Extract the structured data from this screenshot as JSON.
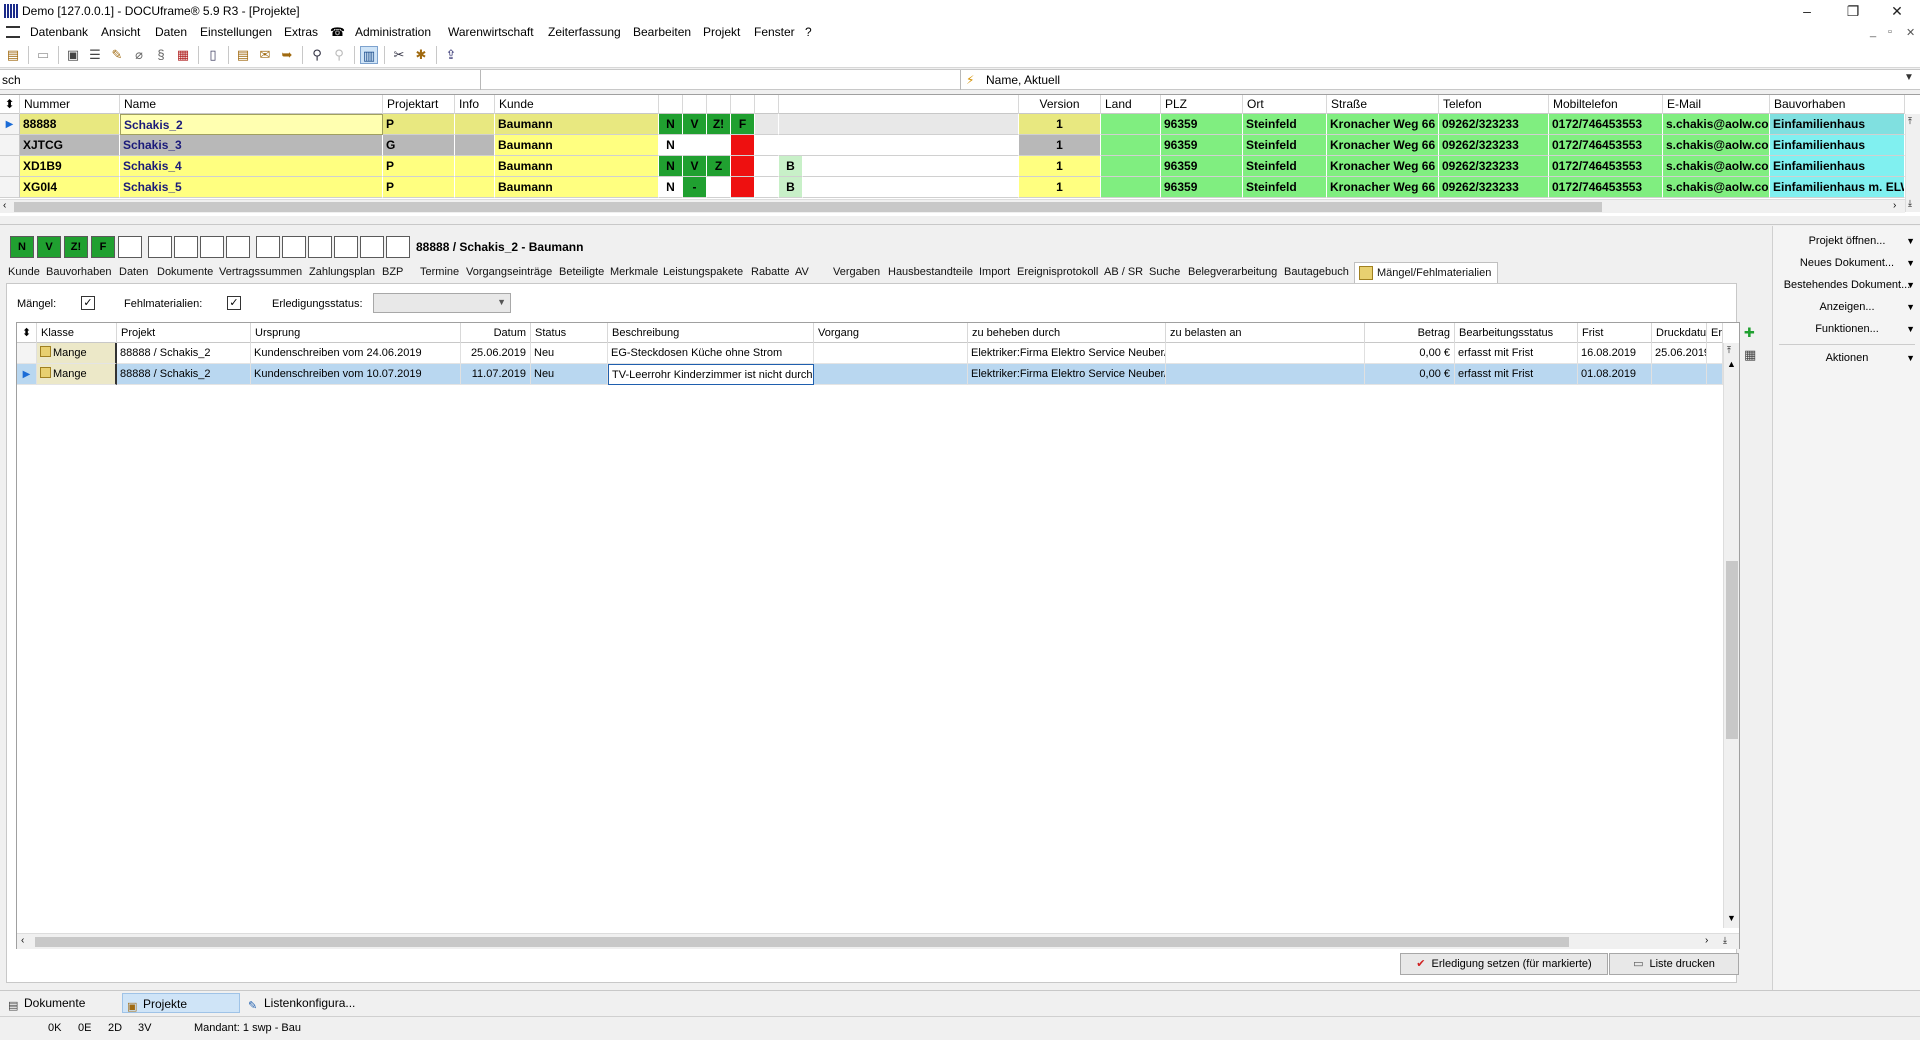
{
  "window": {
    "title": "Demo [127.0.0.1] - DOCUframe® 5.9 R3 - [Projekte]",
    "min_label": "–",
    "max_label": "❐",
    "close_label": "✕"
  },
  "menu": {
    "items": [
      "Datenbank",
      "Ansicht",
      "Daten",
      "Einstellungen",
      "Extras",
      "Administration",
      "Warenwirtschaft",
      "Zeiterfassung",
      "Bearbeiten",
      "Projekt",
      "Fenster",
      "?"
    ],
    "phone_icon": "☎"
  },
  "search": {
    "value": "sch",
    "filter_label": "Name, Aktuell"
  },
  "projects_grid": {
    "columns": [
      "Nummer",
      "Name",
      "Projektart",
      "Info",
      "Kunde",
      "",
      "",
      "",
      "",
      "",
      "",
      "Version",
      "Land",
      "PLZ",
      "Ort",
      "Straße",
      "Telefon",
      "Mobiltelefon",
      "E-Mail",
      "Bauvorhaben"
    ],
    "rows": [
      {
        "nummer": "88888",
        "name": "Schakis_2",
        "art": "P",
        "info": "",
        "kunde": "Baumann",
        "f1": "N",
        "f2": "V",
        "f3": "Z!",
        "f4": "F",
        "f5": "",
        "f6": "",
        "version": "1",
        "land": "",
        "plz": "96359",
        "ort": "Steinfeld",
        "strasse": "Kronacher Weg 66",
        "telefon": "09262/323233",
        "mobil": "0172/746453553",
        "email": "s.chakis@aolw.cor",
        "bauvorhaben": "Einfamilienhaus"
      },
      {
        "nummer": "XJTCG",
        "name": "Schakis_3",
        "art": "G",
        "info": "",
        "kunde": "Baumann",
        "f1": "N",
        "f2": "",
        "f3": "",
        "f4": "",
        "f5": "",
        "f6": "",
        "version": "1",
        "land": "",
        "plz": "96359",
        "ort": "Steinfeld",
        "strasse": "Kronacher Weg 66",
        "telefon": "09262/323233",
        "mobil": "0172/746453553",
        "email": "s.chakis@aolw.cor",
        "bauvorhaben": "Einfamilienhaus"
      },
      {
        "nummer": "XD1B9",
        "name": "Schakis_4",
        "art": "P",
        "info": "",
        "kunde": "Baumann",
        "f1": "N",
        "f2": "V",
        "f3": "Z",
        "f4": "",
        "f5": "B",
        "f6": "",
        "version": "1",
        "land": "",
        "plz": "96359",
        "ort": "Steinfeld",
        "strasse": "Kronacher Weg 66",
        "telefon": "09262/323233",
        "mobil": "0172/746453553",
        "email": "s.chakis@aolw.cor",
        "bauvorhaben": "Einfamilienhaus"
      },
      {
        "nummer": "XG0I4",
        "name": "Schakis_5",
        "art": "P",
        "info": "",
        "kunde": "Baumann",
        "f1": "N",
        "f2": "-",
        "f3": "",
        "f4": "",
        "f5": "B",
        "f6": "",
        "version": "1",
        "land": "",
        "plz": "96359",
        "ort": "Steinfeld",
        "strasse": "Kronacher Weg 66",
        "telefon": "09262/323233",
        "mobil": "0172/746453553",
        "email": "s.chakis@aolw.cor",
        "bauvorhaben": "Einfamilienhaus m. ELW"
      }
    ]
  },
  "detail": {
    "flags": [
      "N",
      "V",
      "Z!",
      "F",
      "",
      "",
      "",
      "",
      "",
      "",
      "",
      "",
      "",
      "",
      ""
    ],
    "title": "88888 / Schakis_2 - Baumann",
    "tabs": [
      "Kunde",
      "Bauvorhaben",
      "Daten",
      "Dokumente",
      "Vertragssummen",
      "Zahlungsplan",
      "BZP",
      "Termine",
      "Vorgangseinträge",
      "Beteiligte",
      "Merkmale",
      "Leistungspakete",
      "Rabatte",
      "AV",
      "Vergaben",
      "Hausbestandteile",
      "Import",
      "Ereignisprotokoll",
      "AB / SR",
      "Suche",
      "Belegverarbeitung",
      "Bautagebuch"
    ],
    "active_tab": "Mängel/Fehlmaterialien",
    "options": {
      "maengel_label": "Mängel:",
      "maengel_checked": "✓",
      "fehl_label": "Fehlmaterialien:",
      "fehl_checked": "✓",
      "status_label": "Erledigungsstatus:",
      "status_value": ""
    }
  },
  "defects_grid": {
    "columns": [
      "Klasse",
      "Projekt",
      "Ursprung",
      "Datum",
      "Status",
      "Beschreibung",
      "Vorgang",
      "zu beheben durch",
      "zu belasten an",
      "Betrag",
      "Bearbeitungsstatus",
      "Frist",
      "Druckdatum",
      "Erle"
    ],
    "rows": [
      {
        "klasse": "Mange",
        "projekt": "88888 / Schakis_2",
        "ursprung": "Kundenschreiben vom 24.06.2019",
        "datum": "25.06.2019",
        "status": "Neu",
        "beschreibung": "EG-Steckdosen Küche ohne Strom",
        "vorgang": "",
        "beheben": "Elektriker:Firma Elektro Service Neuber/E",
        "belasten": "",
        "betrag": "0,00 €",
        "bearbeitung": "erfasst mit Frist",
        "frist": "16.08.2019",
        "druckdatum": "25.06.2019",
        "erle": ""
      },
      {
        "klasse": "Mange",
        "projekt": "88888 / Schakis_2",
        "ursprung": "Kundenschreiben vom 10.07.2019",
        "datum": "11.07.2019",
        "status": "Neu",
        "beschreibung": "TV-Leerrohr Kinderzimmer ist nicht durch",
        "vorgang": "",
        "beheben": "Elektriker:Firma Elektro Service Neuber/E",
        "belasten": "",
        "betrag": "0,00 €",
        "bearbeitung": "erfasst mit Frist",
        "frist": "01.08.2019",
        "druckdatum": "",
        "erle": ""
      }
    ]
  },
  "buttons": {
    "erledigung": "Erledigung setzen (für markierte)",
    "drucken": "Liste drucken"
  },
  "actions": [
    "Projekt öffnen...",
    "Neues Dokument...",
    "Bestehendes Dokument...",
    "Anzeigen...",
    "Funktionen...",
    "Aktionen"
  ],
  "bottom_tabs": [
    "Dokumente",
    "Projekte",
    "Listenkonfigura..."
  ],
  "status": {
    "s1": "0K",
    "s2": "0E",
    "s3": "2D",
    "s4": "3V",
    "mandant": "Mandant: 1 swp - Bau"
  },
  "colors": {
    "row_yellow": "#ffff80",
    "row_gray": "#b8b8b8",
    "green": "#20a030",
    "light_green": "#80ee80",
    "red": "#ee1010",
    "cyan": "#80f0f0",
    "selection": "#b9d7f0"
  }
}
